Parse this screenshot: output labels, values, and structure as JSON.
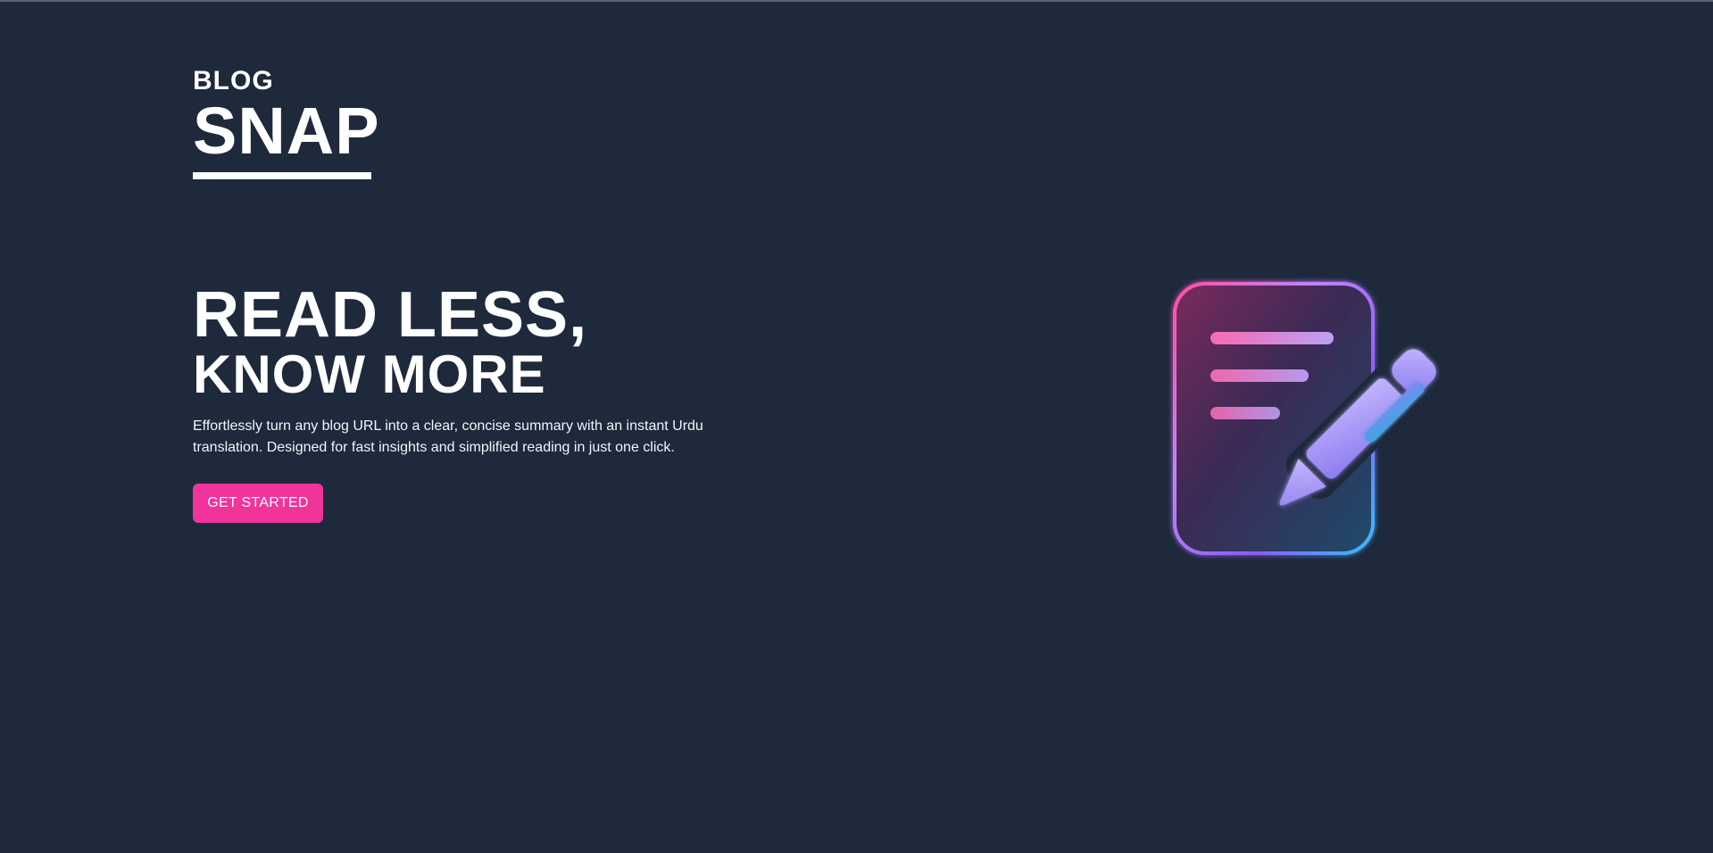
{
  "brand": {
    "small": "BLOG",
    "big": "SNAP"
  },
  "hero": {
    "headline_line1": "READ LESS,",
    "headline_line2": "KNOW MORE",
    "description": "Effortlessly turn any blog URL into a clear, concise summary with an instant Urdu translation. Designed for fast insights and simplified reading in just one click.",
    "cta_label": "GET STARTED"
  },
  "illustration": {
    "icon": "document-pencil-icon"
  },
  "colors": {
    "background": "#1e293b",
    "accent": "#f0349a",
    "text": "#ffffff",
    "gradient_pink": "#ff4fa3",
    "gradient_purple": "#a78bfa",
    "gradient_cyan": "#38bdf8"
  }
}
